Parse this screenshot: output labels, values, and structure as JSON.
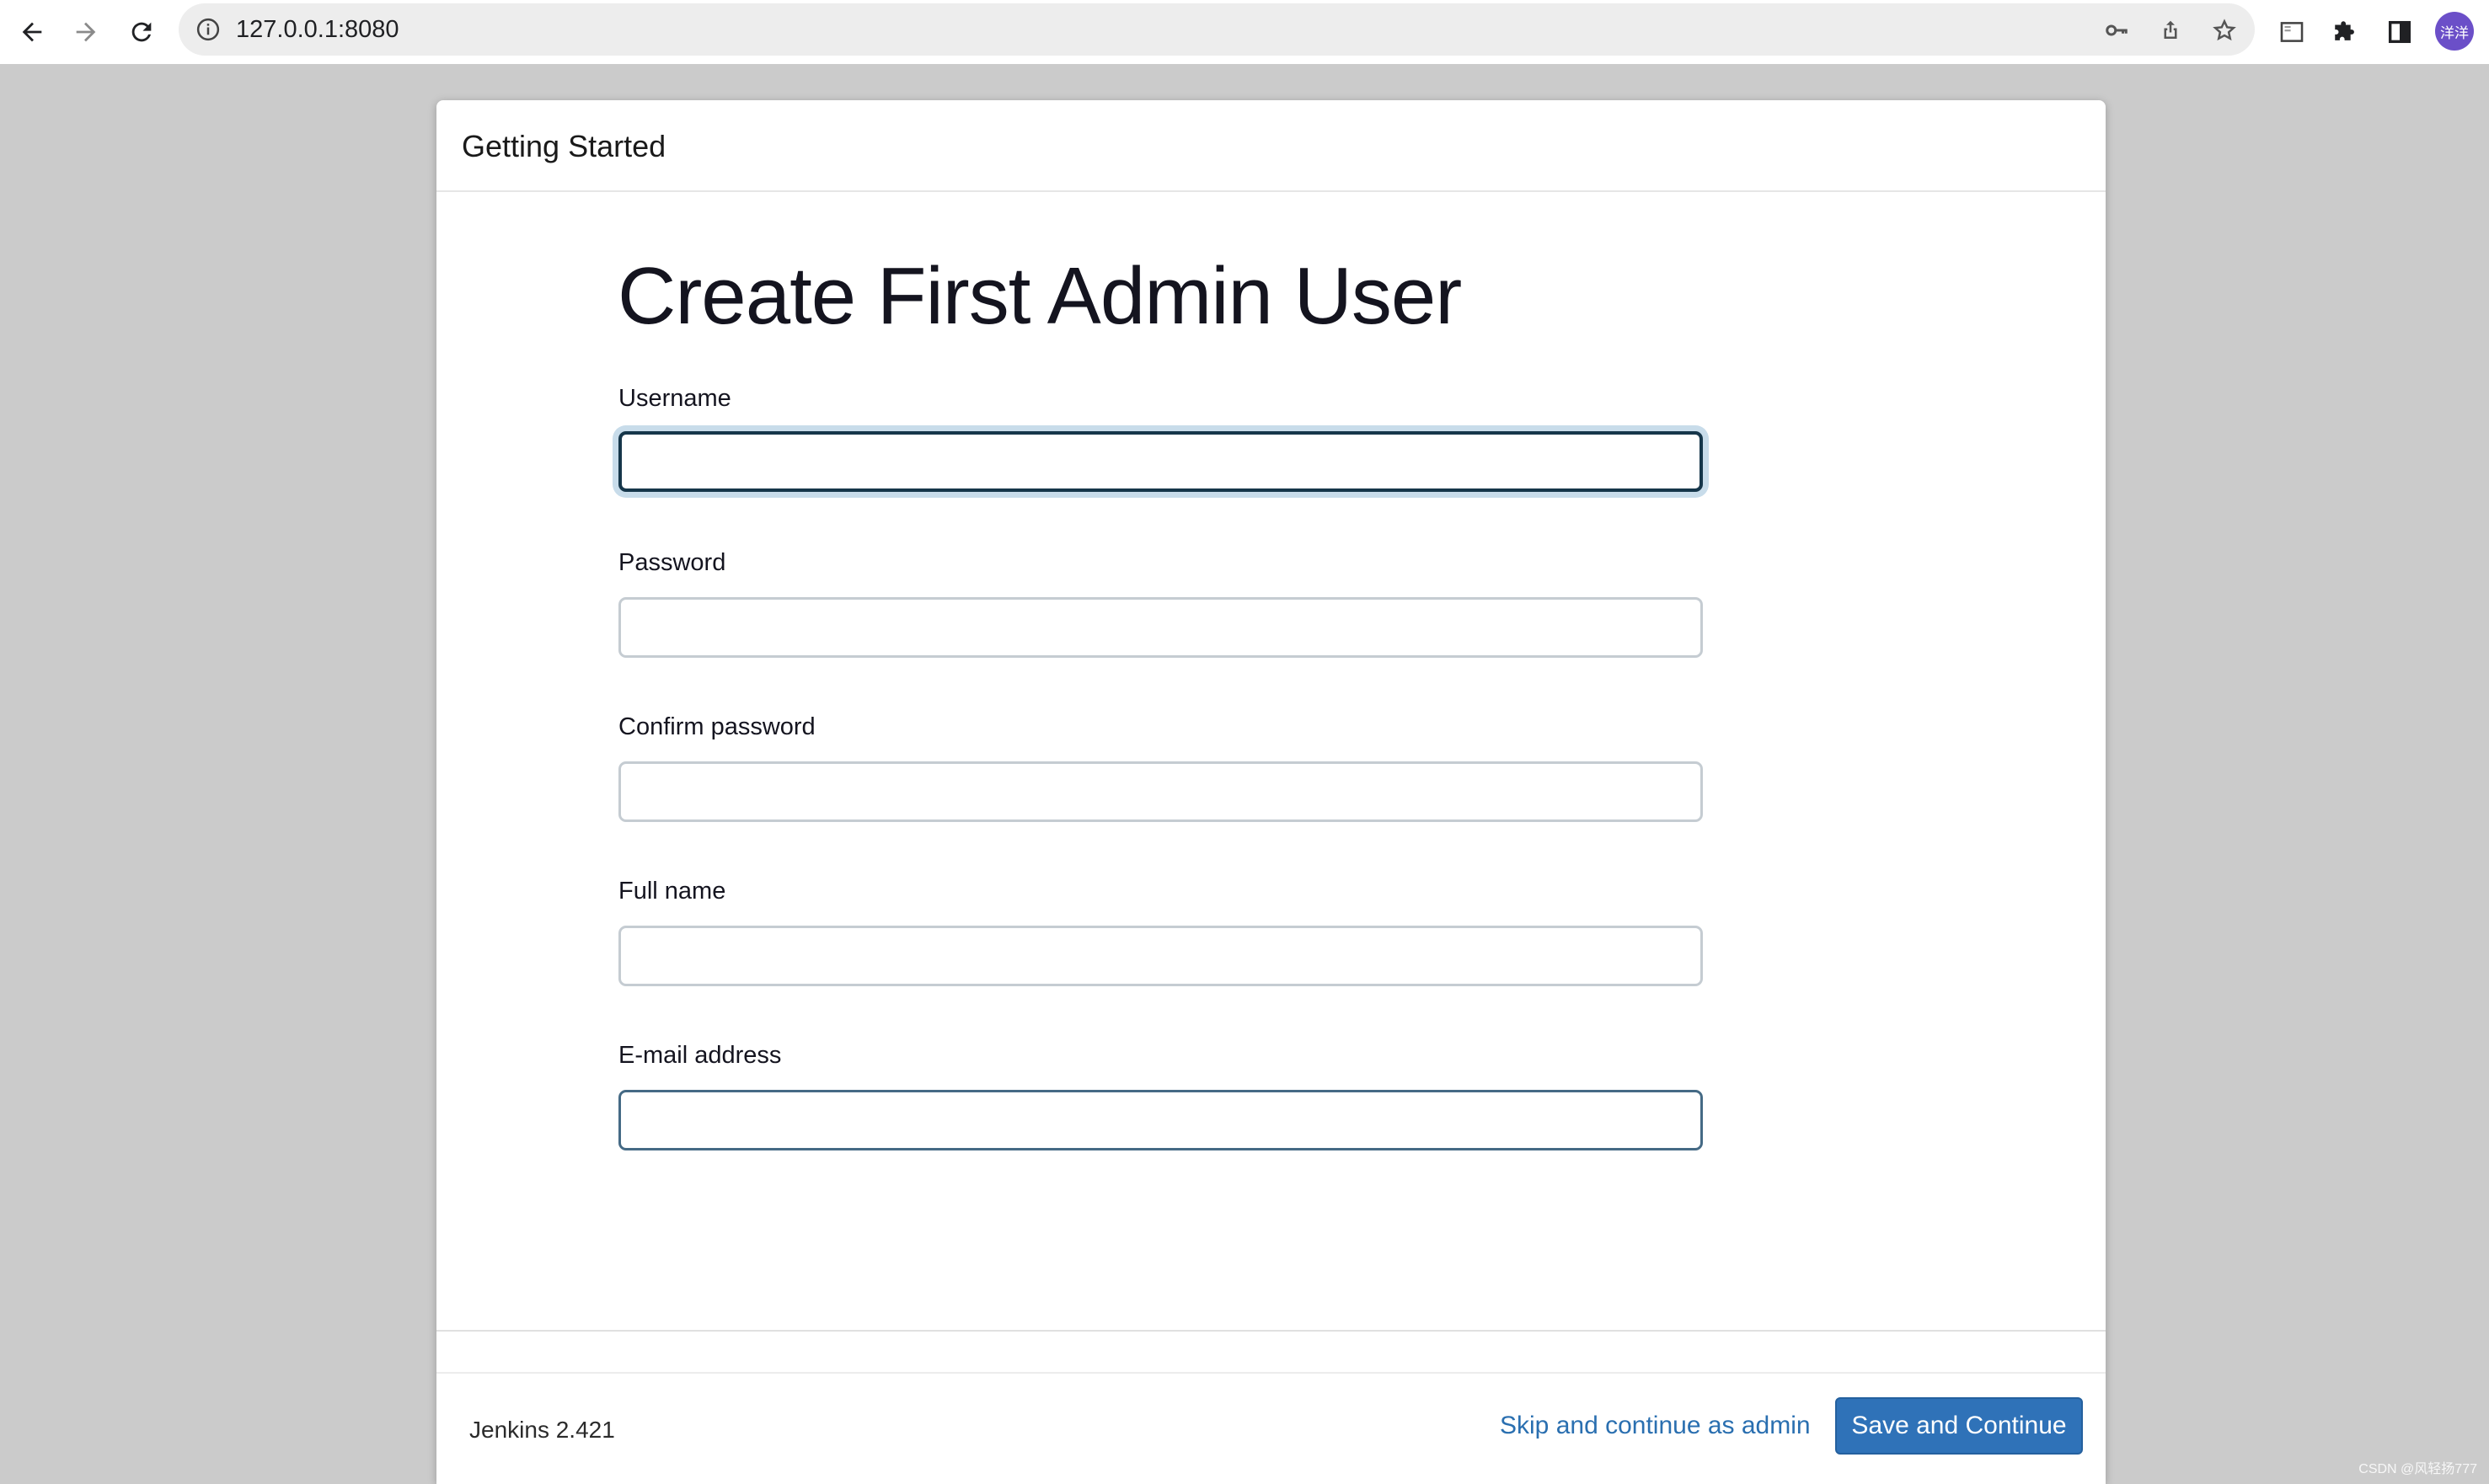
{
  "browser": {
    "url": "127.0.0.1:8080",
    "avatar_text": "洋洋",
    "icons": [
      "back-arrow-icon",
      "forward-arrow-icon",
      "reload-icon",
      "info-icon",
      "key-icon",
      "share-icon",
      "star-icon",
      "reading-mode-icon",
      "extensions-icon",
      "side-panel-icon"
    ]
  },
  "dialog": {
    "title": "Getting Started",
    "heading": "Create First Admin User",
    "fields": [
      {
        "label": "Username",
        "value": ""
      },
      {
        "label": "Password",
        "value": ""
      },
      {
        "label": "Confirm password",
        "value": ""
      },
      {
        "label": "Full name",
        "value": ""
      },
      {
        "label": "E-mail address",
        "value": ""
      }
    ],
    "footer": {
      "version": "Jenkins 2.421",
      "skip_label": "Skip and continue as admin",
      "save_label": "Save and Continue"
    }
  },
  "watermark": "CSDN @风轻扬777",
  "colors": {
    "page_background": "#cbcbcb",
    "primary_button": "#2f72b8",
    "link": "#2a6fb0",
    "focus_border": "#16364a"
  }
}
